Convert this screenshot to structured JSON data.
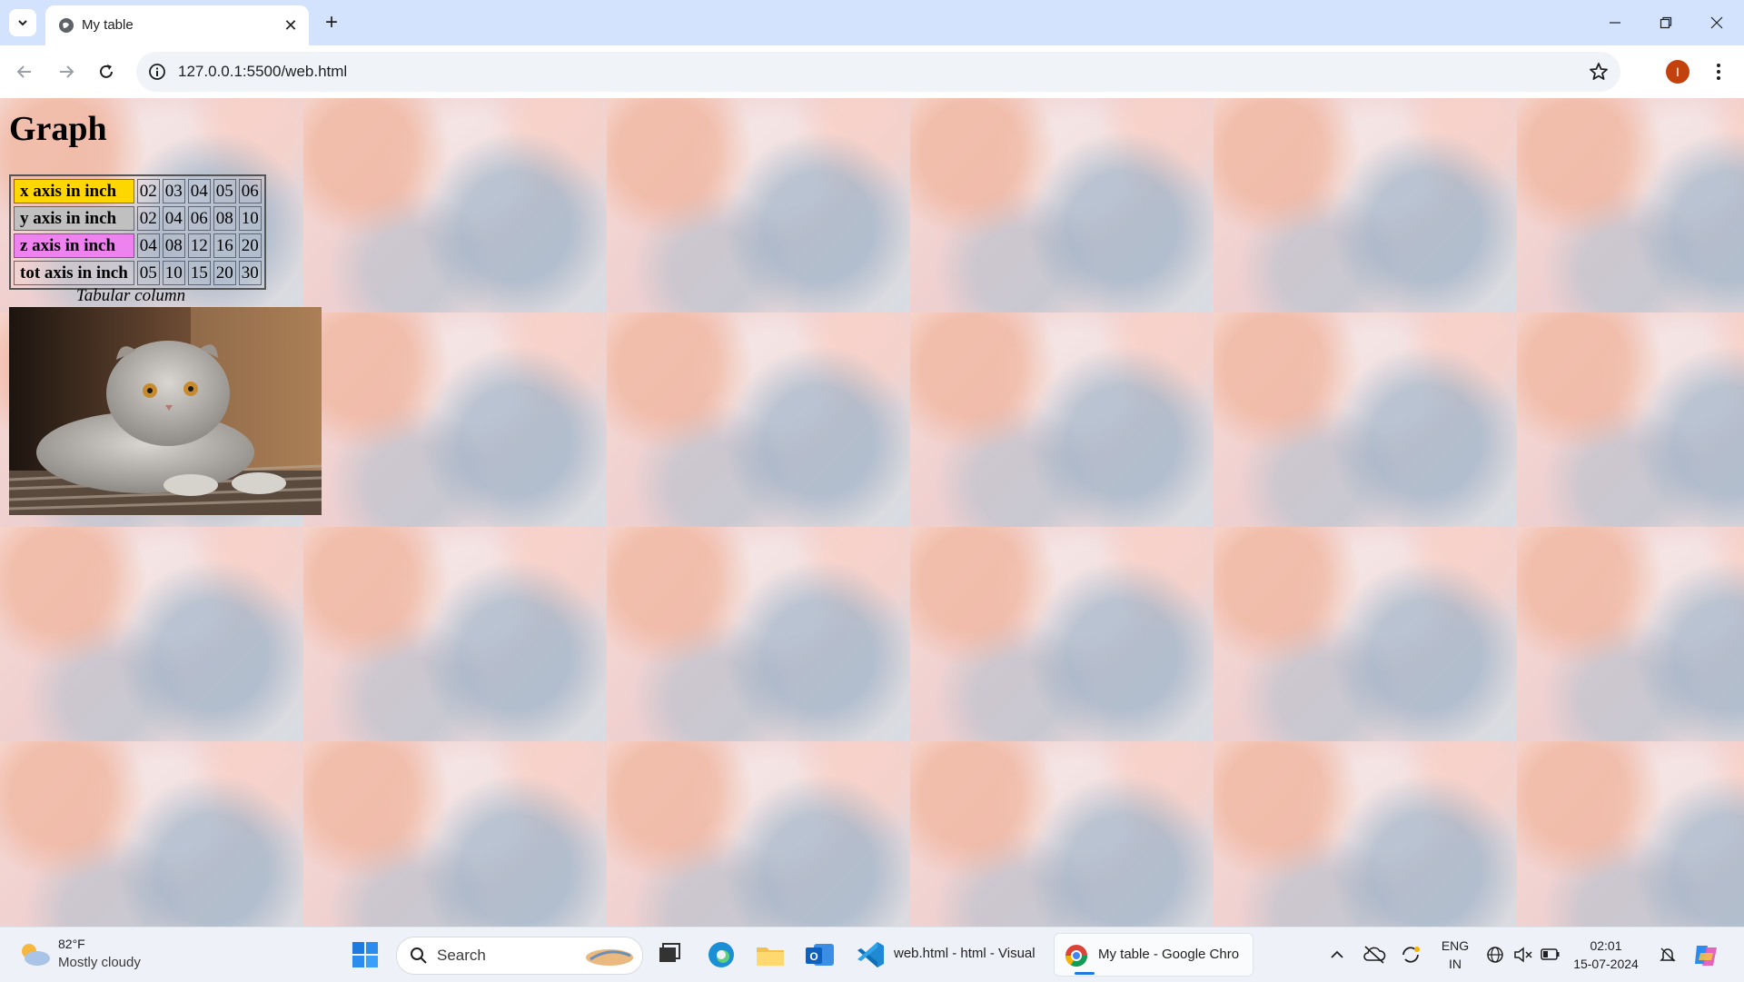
{
  "browser": {
    "tab_title": "My table",
    "url": "127.0.0.1:5500/web.html",
    "profile_initial": "I"
  },
  "page": {
    "heading": "Graph",
    "table": {
      "rows": [
        {
          "label": "x axis in inch",
          "color": "#ffd700",
          "values": [
            "02",
            "03",
            "04",
            "05",
            "06"
          ]
        },
        {
          "label": "y axis in inch",
          "color": "#c0c0c0",
          "values": [
            "02",
            "04",
            "06",
            "08",
            "10"
          ]
        },
        {
          "label": "z axis in inch",
          "color": "#ee82ee",
          "values": [
            "04",
            "08",
            "12",
            "16",
            "20"
          ]
        },
        {
          "label": "tot axis in inch",
          "color": "transparent",
          "values": [
            "05",
            "10",
            "15",
            "20",
            "30"
          ]
        }
      ]
    },
    "caption": "Tabular column"
  },
  "taskbar": {
    "weather_temp": "82°F",
    "weather_desc": "Mostly cloudy",
    "search_label": "Search",
    "vscode_window": "web.html - html - Visual",
    "chrome_window": "My table - Google Chro",
    "lang_top": "ENG",
    "lang_bottom": "IN",
    "time": "02:01",
    "date": "15-07-2024"
  }
}
